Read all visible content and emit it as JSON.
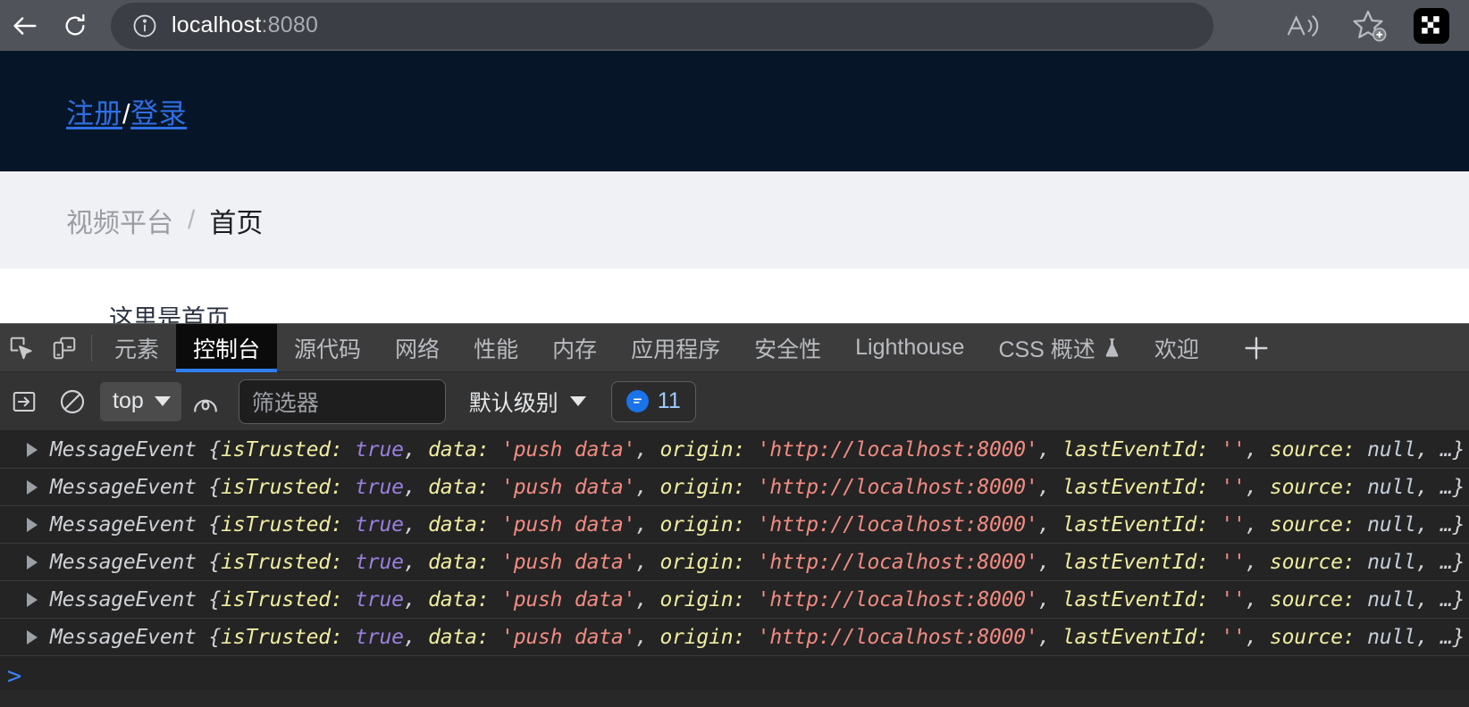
{
  "browser": {
    "back_label": "back-arrow",
    "reload_label": "reload",
    "url_host": "localhost",
    "url_port": ":8080",
    "read_aloud_label": "read-aloud",
    "favorite_label": "add-to-favorites",
    "extension_label": "extension"
  },
  "page": {
    "auth": {
      "register": "注册",
      "separator": "/",
      "login": "登录"
    },
    "breadcrumb": {
      "root": "视频平台",
      "separator": "/",
      "current": "首页"
    },
    "card_text": "这里是首页"
  },
  "devtools": {
    "tabs": [
      {
        "label": "元素",
        "selected": false
      },
      {
        "label": "控制台",
        "selected": true
      },
      {
        "label": "源代码",
        "selected": false
      },
      {
        "label": "网络",
        "selected": false
      },
      {
        "label": "性能",
        "selected": false
      },
      {
        "label": "内存",
        "selected": false
      },
      {
        "label": "应用程序",
        "selected": false
      },
      {
        "label": "安全性",
        "selected": false
      },
      {
        "label": "Lighthouse",
        "selected": false
      },
      {
        "label": "CSS 概述",
        "selected": false,
        "flask": true
      },
      {
        "label": "欢迎",
        "selected": false
      }
    ],
    "add_tab_label": "+",
    "toolbar": {
      "context": "top",
      "filter_placeholder": "筛选器",
      "filter_value": "",
      "levels": "默认级别",
      "issues_count": "11"
    },
    "console": {
      "entries": [
        {
          "class_name": "MessageEvent",
          "open_brace": "{",
          "props": [
            {
              "key": "isTrusted:",
              "value": "true",
              "type": "bool",
              "comma": ","
            },
            {
              "key": "data:",
              "value": "'push data'",
              "type": "str",
              "comma": ","
            },
            {
              "key": "origin:",
              "value": "'http://localhost:8000'",
              "type": "str",
              "comma": ","
            },
            {
              "key": "lastEventId:",
              "value": "''",
              "type": "str",
              "comma": ","
            },
            {
              "key": "source:",
              "value": "null",
              "type": "null",
              "comma": ","
            }
          ],
          "ellipsis": "…}"
        },
        {
          "class_name": "MessageEvent",
          "open_brace": "{",
          "props": [
            {
              "key": "isTrusted:",
              "value": "true",
              "type": "bool",
              "comma": ","
            },
            {
              "key": "data:",
              "value": "'push data'",
              "type": "str",
              "comma": ","
            },
            {
              "key": "origin:",
              "value": "'http://localhost:8000'",
              "type": "str",
              "comma": ","
            },
            {
              "key": "lastEventId:",
              "value": "''",
              "type": "str",
              "comma": ","
            },
            {
              "key": "source:",
              "value": "null",
              "type": "null",
              "comma": ","
            }
          ],
          "ellipsis": "…}"
        },
        {
          "class_name": "MessageEvent",
          "open_brace": "{",
          "props": [
            {
              "key": "isTrusted:",
              "value": "true",
              "type": "bool",
              "comma": ","
            },
            {
              "key": "data:",
              "value": "'push data'",
              "type": "str",
              "comma": ","
            },
            {
              "key": "origin:",
              "value": "'http://localhost:8000'",
              "type": "str",
              "comma": ","
            },
            {
              "key": "lastEventId:",
              "value": "''",
              "type": "str",
              "comma": ","
            },
            {
              "key": "source:",
              "value": "null",
              "type": "null",
              "comma": ","
            }
          ],
          "ellipsis": "…}"
        },
        {
          "class_name": "MessageEvent",
          "open_brace": "{",
          "props": [
            {
              "key": "isTrusted:",
              "value": "true",
              "type": "bool",
              "comma": ","
            },
            {
              "key": "data:",
              "value": "'push data'",
              "type": "str",
              "comma": ","
            },
            {
              "key": "origin:",
              "value": "'http://localhost:8000'",
              "type": "str",
              "comma": ","
            },
            {
              "key": "lastEventId:",
              "value": "''",
              "type": "str",
              "comma": ","
            },
            {
              "key": "source:",
              "value": "null",
              "type": "null",
              "comma": ","
            }
          ],
          "ellipsis": "…}"
        },
        {
          "class_name": "MessageEvent",
          "open_brace": "{",
          "props": [
            {
              "key": "isTrusted:",
              "value": "true",
              "type": "bool",
              "comma": ","
            },
            {
              "key": "data:",
              "value": "'push data'",
              "type": "str",
              "comma": ","
            },
            {
              "key": "origin:",
              "value": "'http://localhost:8000'",
              "type": "str",
              "comma": ","
            },
            {
              "key": "lastEventId:",
              "value": "''",
              "type": "str",
              "comma": ","
            },
            {
              "key": "source:",
              "value": "null",
              "type": "null",
              "comma": ","
            }
          ],
          "ellipsis": "…}"
        },
        {
          "class_name": "MessageEvent",
          "open_brace": "{",
          "props": [
            {
              "key": "isTrusted:",
              "value": "true",
              "type": "bool",
              "comma": ","
            },
            {
              "key": "data:",
              "value": "'push data'",
              "type": "str",
              "comma": ","
            },
            {
              "key": "origin:",
              "value": "'http://localhost:8000'",
              "type": "str",
              "comma": ","
            },
            {
              "key": "lastEventId:",
              "value": "''",
              "type": "str",
              "comma": ","
            },
            {
              "key": "source:",
              "value": "null",
              "type": "null",
              "comma": ","
            }
          ],
          "ellipsis": "…}"
        }
      ],
      "prompt": ">"
    }
  },
  "colors": {
    "accent_blue": "#2f6fe4",
    "devtools_selected": "#2f7ff4",
    "string_token": "#f28b82",
    "key_token": "#f0eda0",
    "bool_token": "#9a7fe0",
    "site_header": "#061528"
  }
}
